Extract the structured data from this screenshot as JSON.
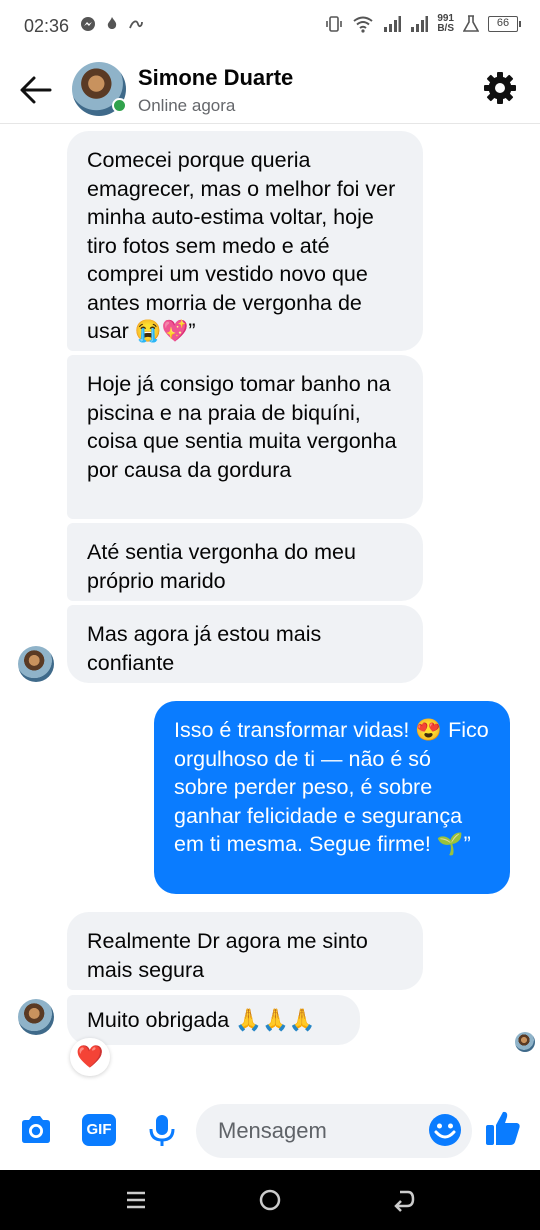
{
  "status_bar": {
    "time": "02:36",
    "speed_top": "991",
    "speed_bottom": "B/S",
    "battery": "66"
  },
  "header": {
    "name": "Simone Duarte",
    "status": "Online agora"
  },
  "messages": [
    {
      "direction": "in",
      "text": "Comecei porque queria emagrecer, mas o melhor foi ver minha auto-estima voltar, hoje tiro fotos sem medo e até comprei um vestido novo que antes morria de vergonha de usar 😭💖”"
    },
    {
      "direction": "in",
      "text": "Hoje já consigo tomar banho na piscina e na praia de biquíni, coisa que sentia muita vergonha  por causa da gordura"
    },
    {
      "direction": "in",
      "text": "Até sentia vergonha do meu próprio marido"
    },
    {
      "direction": "in",
      "text": "Mas agora já estou mais confiante"
    },
    {
      "direction": "out",
      "text": "Isso é transformar vidas! 😍 Fico orgulhoso de ti — não é só sobre perder peso, é sobre ganhar felicidade e segurança em ti mesma. Segue firme! 🌱”"
    },
    {
      "direction": "in",
      "text": "Realmente Dr agora me sinto mais segura"
    },
    {
      "direction": "in",
      "text": "Muito obrigada 🙏🙏🙏"
    }
  ],
  "reaction": "❤️",
  "composer": {
    "placeholder": "Mensagem",
    "gif_label": "GIF"
  },
  "colors": {
    "accent": "#0a7cff",
    "incoming_bubble": "#f0f2f5",
    "online": "#31a24c"
  },
  "icons": [
    "back-arrow-icon",
    "gear-icon",
    "camera-icon",
    "microphone-icon",
    "emoji-icon",
    "thumbs-up-icon"
  ]
}
